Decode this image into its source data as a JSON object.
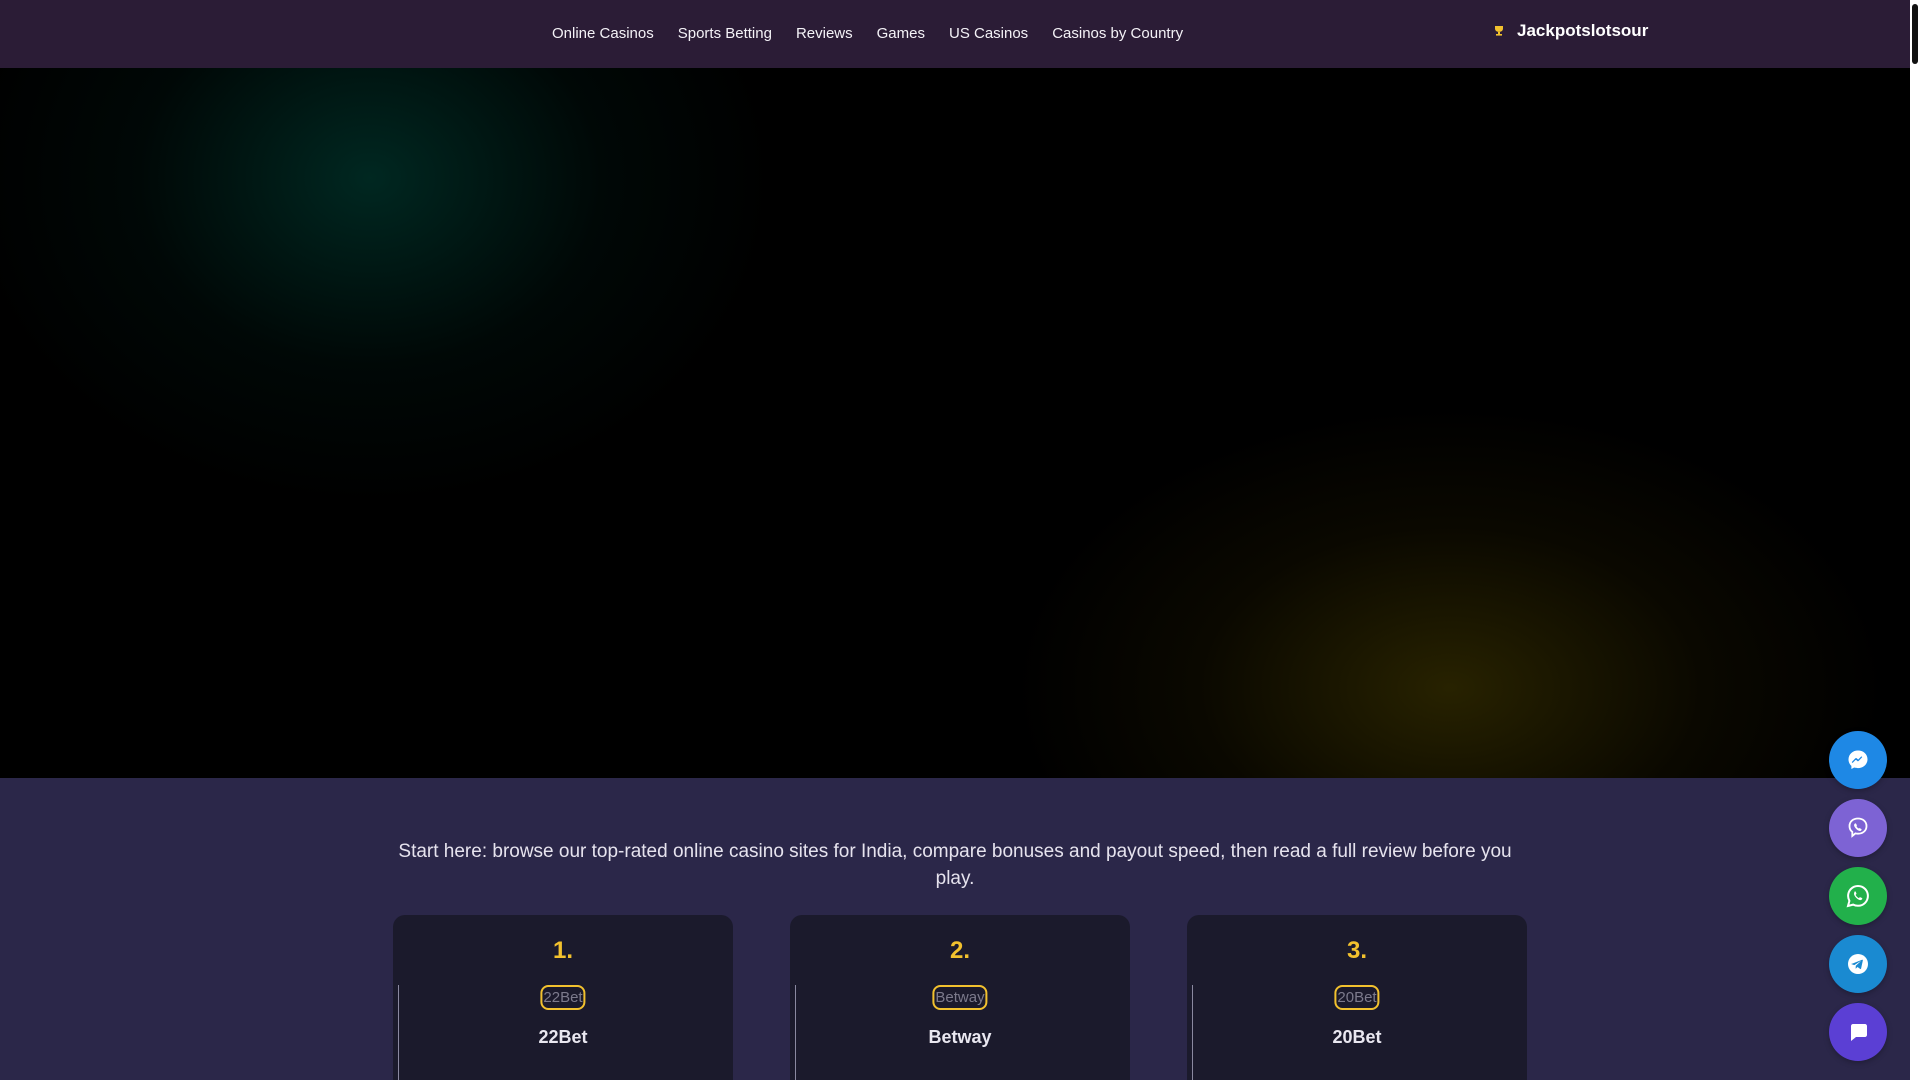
{
  "header": {
    "nav": [
      "Online Casinos",
      "Sports Betting",
      "Reviews",
      "Games",
      "US Casinos",
      "Casinos by Country"
    ],
    "brand_name": "Jackpotslotsour",
    "brand_icon": "trophy-icon"
  },
  "intro_text": "Start here: browse our top-rated online casino sites for India, compare bonuses and payout speed, then read a full review before you play.",
  "cards": [
    {
      "rank": "1.",
      "logo_alt": "22Bet",
      "name": "22Bet"
    },
    {
      "rank": "2.",
      "logo_alt": "Betway",
      "name": "Betway"
    },
    {
      "rank": "3.",
      "logo_alt": "20Bet",
      "name": "20Bet"
    }
  ],
  "contact_buttons": [
    {
      "icon": "messenger-icon",
      "color": "#1e88e5"
    },
    {
      "icon": "viber-icon",
      "color": "#7d63d4"
    },
    {
      "icon": "whatsapp-icon",
      "color": "#22b04b"
    },
    {
      "icon": "telegram-icon",
      "color": "#1a8ad1"
    },
    {
      "icon": "chat-icon",
      "color": "#5b3fd4"
    }
  ],
  "colors": {
    "header_bg": "#2b1c36",
    "page_bg": "#2b2749",
    "card_bg": "#1b1a2c",
    "accent_gold": "#f2c12e"
  }
}
